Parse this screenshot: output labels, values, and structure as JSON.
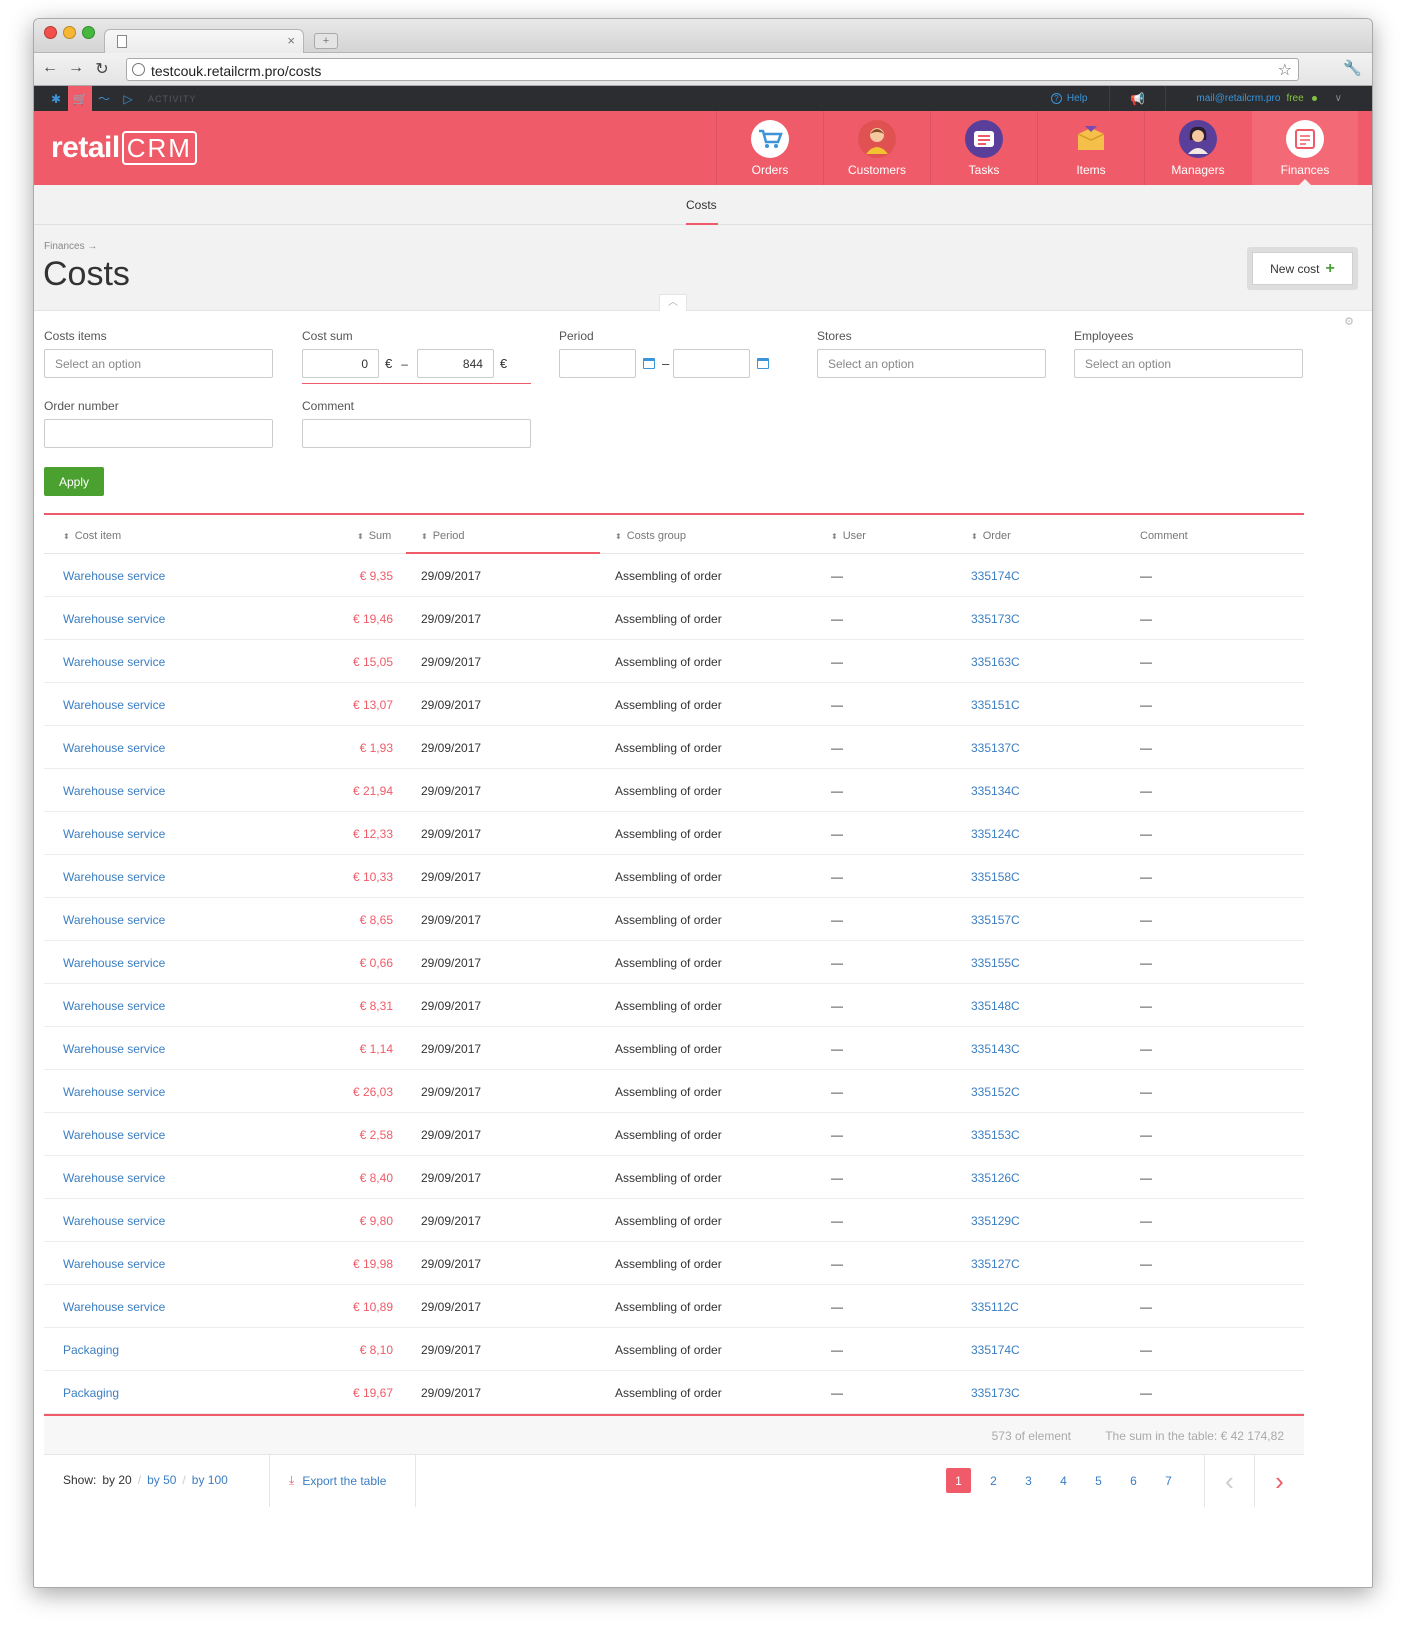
{
  "browser": {
    "url": "testcouk.retailcrm.pro/costs"
  },
  "appbar": {
    "activity_label": "ACTIVITY",
    "help_label": "Help",
    "user_email": "mail@retailcrm.pro",
    "plan_label": "free"
  },
  "header": {
    "logo_text": "retail",
    "logo_crm": "CRM",
    "nav": [
      {
        "label": "Orders",
        "icon": "cart-icon"
      },
      {
        "label": "Customers",
        "icon": "customer-avatar-icon"
      },
      {
        "label": "Tasks",
        "icon": "tasks-list-icon"
      },
      {
        "label": "Items",
        "icon": "box-icon"
      },
      {
        "label": "Managers",
        "icon": "manager-avatar-icon"
      },
      {
        "label": "Finances",
        "icon": "finances-doc-icon"
      }
    ]
  },
  "subnav": {
    "tab": "Costs"
  },
  "page": {
    "breadcrumb": "Finances →",
    "title": "Costs",
    "new_cost_label": "New cost"
  },
  "filters": {
    "costs_items": {
      "label": "Costs items",
      "placeholder": "Select an option"
    },
    "cost_sum": {
      "label": "Cost sum",
      "from": "0",
      "to": "844",
      "unit": "€"
    },
    "period": {
      "label": "Period"
    },
    "stores": {
      "label": "Stores",
      "placeholder": "Select an option"
    },
    "employees": {
      "label": "Employees",
      "placeholder": "Select an option"
    },
    "order_number": {
      "label": "Order number"
    },
    "comment": {
      "label": "Comment"
    },
    "apply_label": "Apply"
  },
  "table": {
    "columns": [
      "Cost item",
      "Sum",
      "Period",
      "Costs group",
      "User",
      "Order",
      "Comment"
    ],
    "rows": [
      {
        "item": "Warehouse service",
        "sum": "€ 9,35",
        "period": "29/09/2017",
        "group": "Assembling of order",
        "user": "—",
        "order": "335174C",
        "comment": "—"
      },
      {
        "item": "Warehouse service",
        "sum": "€ 19,46",
        "period": "29/09/2017",
        "group": "Assembling of order",
        "user": "—",
        "order": "335173C",
        "comment": "—"
      },
      {
        "item": "Warehouse service",
        "sum": "€ 15,05",
        "period": "29/09/2017",
        "group": "Assembling of order",
        "user": "—",
        "order": "335163C",
        "comment": "—"
      },
      {
        "item": "Warehouse service",
        "sum": "€ 13,07",
        "period": "29/09/2017",
        "group": "Assembling of order",
        "user": "—",
        "order": "335151C",
        "comment": "—"
      },
      {
        "item": "Warehouse service",
        "sum": "€ 1,93",
        "period": "29/09/2017",
        "group": "Assembling of order",
        "user": "—",
        "order": "335137C",
        "comment": "—"
      },
      {
        "item": "Warehouse service",
        "sum": "€ 21,94",
        "period": "29/09/2017",
        "group": "Assembling of order",
        "user": "—",
        "order": "335134C",
        "comment": "—"
      },
      {
        "item": "Warehouse service",
        "sum": "€ 12,33",
        "period": "29/09/2017",
        "group": "Assembling of order",
        "user": "—",
        "order": "335124C",
        "comment": "—"
      },
      {
        "item": "Warehouse service",
        "sum": "€ 10,33",
        "period": "29/09/2017",
        "group": "Assembling of order",
        "user": "—",
        "order": "335158C",
        "comment": "—"
      },
      {
        "item": "Warehouse service",
        "sum": "€ 8,65",
        "period": "29/09/2017",
        "group": "Assembling of order",
        "user": "—",
        "order": "335157C",
        "comment": "—"
      },
      {
        "item": "Warehouse service",
        "sum": "€ 0,66",
        "period": "29/09/2017",
        "group": "Assembling of order",
        "user": "—",
        "order": "335155C",
        "comment": "—"
      },
      {
        "item": "Warehouse service",
        "sum": "€ 8,31",
        "period": "29/09/2017",
        "group": "Assembling of order",
        "user": "—",
        "order": "335148C",
        "comment": "—"
      },
      {
        "item": "Warehouse service",
        "sum": "€ 1,14",
        "period": "29/09/2017",
        "group": "Assembling of order",
        "user": "—",
        "order": "335143C",
        "comment": "—"
      },
      {
        "item": "Warehouse service",
        "sum": "€ 26,03",
        "period": "29/09/2017",
        "group": "Assembling of order",
        "user": "—",
        "order": "335152C",
        "comment": "—"
      },
      {
        "item": "Warehouse service",
        "sum": "€ 2,58",
        "period": "29/09/2017",
        "group": "Assembling of order",
        "user": "—",
        "order": "335153C",
        "comment": "—"
      },
      {
        "item": "Warehouse service",
        "sum": "€ 8,40",
        "period": "29/09/2017",
        "group": "Assembling of order",
        "user": "—",
        "order": "335126C",
        "comment": "—"
      },
      {
        "item": "Warehouse service",
        "sum": "€ 9,80",
        "period": "29/09/2017",
        "group": "Assembling of order",
        "user": "—",
        "order": "335129C",
        "comment": "—"
      },
      {
        "item": "Warehouse service",
        "sum": "€ 19,98",
        "period": "29/09/2017",
        "group": "Assembling of order",
        "user": "—",
        "order": "335127C",
        "comment": "—"
      },
      {
        "item": "Warehouse service",
        "sum": "€ 10,89",
        "period": "29/09/2017",
        "group": "Assembling of order",
        "user": "—",
        "order": "335112C",
        "comment": "—"
      },
      {
        "item": "Packaging",
        "sum": "€ 8,10",
        "period": "29/09/2017",
        "group": "Assembling of order",
        "user": "—",
        "order": "335174C",
        "comment": "—"
      },
      {
        "item": "Packaging",
        "sum": "€ 19,67",
        "period": "29/09/2017",
        "group": "Assembling of order",
        "user": "—",
        "order": "335173C",
        "comment": "—"
      }
    ],
    "count_label": "573 of element",
    "total_label": "The sum in the table: € 42 174,82"
  },
  "pager": {
    "show_label": "Show:",
    "per_page": [
      "by 20",
      "by 50",
      "by 100"
    ],
    "export_label": "Export the table",
    "pages": [
      "1",
      "2",
      "3",
      "4",
      "5",
      "6",
      "7"
    ],
    "current_page": "1"
  },
  "colors": {
    "brand": "#ef5b68",
    "link": "#3b7ec2",
    "apply": "#4ba12f"
  }
}
